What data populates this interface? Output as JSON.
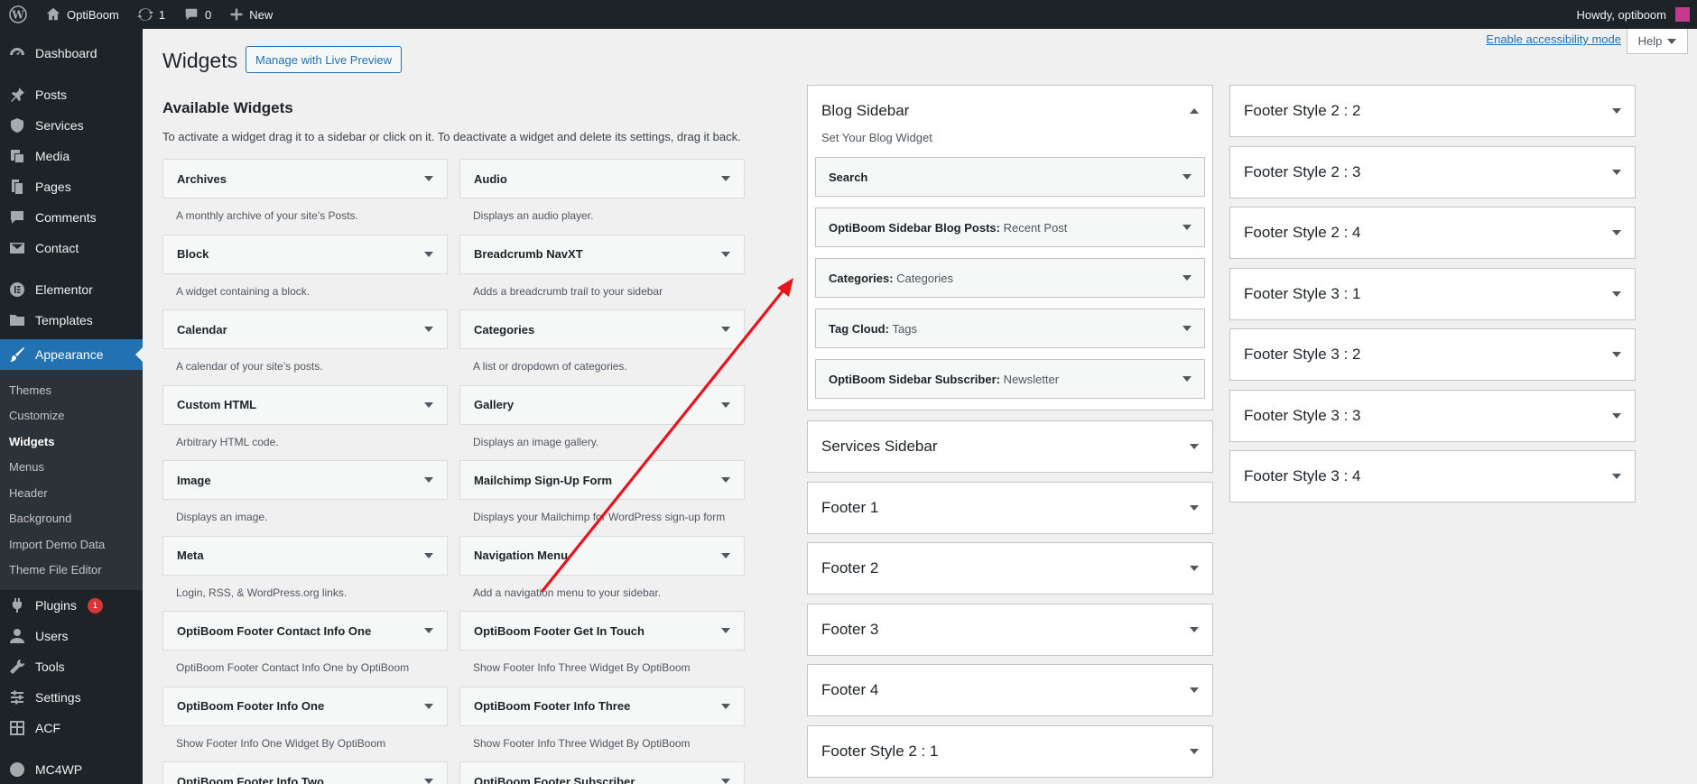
{
  "adminbar": {
    "site_name": "OptiBoom",
    "updates_count": "1",
    "comments_count": "0",
    "new_label": "New",
    "howdy": "Howdy, optiboom"
  },
  "menu": {
    "dashboard": "Dashboard",
    "posts": "Posts",
    "services": "Services",
    "media": "Media",
    "pages": "Pages",
    "comments": "Comments",
    "contact": "Contact",
    "elementor": "Elementor",
    "templates": "Templates",
    "appearance": "Appearance",
    "sub": [
      "Themes",
      "Customize",
      "Widgets",
      "Menus",
      "Header",
      "Background",
      "Import Demo Data",
      "Theme File Editor"
    ],
    "plugins": "Plugins",
    "plugins_badge": "1",
    "users": "Users",
    "tools": "Tools",
    "settings": "Settings",
    "acf": "ACF",
    "mc4wp": "MC4WP"
  },
  "page": {
    "title": "Widgets",
    "live_preview": "Manage with Live Preview",
    "a11y_link": "Enable accessibility mode",
    "help": "Help",
    "available_title": "Available Widgets",
    "available_desc": "To activate a widget drag it to a sidebar or click on it. To deactivate a widget and delete its settings, drag it back."
  },
  "widgets": [
    {
      "title": "Archives",
      "desc": "A monthly archive of your site’s Posts."
    },
    {
      "title": "Audio",
      "desc": "Displays an audio player."
    },
    {
      "title": "Block",
      "desc": "A widget containing a block."
    },
    {
      "title": "Breadcrumb NavXT",
      "desc": "Adds a breadcrumb trail to your sidebar"
    },
    {
      "title": "Calendar",
      "desc": "A calendar of your site’s posts."
    },
    {
      "title": "Categories",
      "desc": "A list or dropdown of categories."
    },
    {
      "title": "Custom HTML",
      "desc": "Arbitrary HTML code."
    },
    {
      "title": "Gallery",
      "desc": "Displays an image gallery."
    },
    {
      "title": "Image",
      "desc": "Displays an image."
    },
    {
      "title": "Mailchimp Sign-Up Form",
      "desc": "Displays your Mailchimp for WordPress sign-up form"
    },
    {
      "title": "Meta",
      "desc": "Login, RSS, & WordPress.org links."
    },
    {
      "title": "Navigation Menu",
      "desc": "Add a navigation menu to your sidebar."
    },
    {
      "title": "OptiBoom Footer Contact Info One",
      "desc": "OptiBoom Footer Contact Info One by OptiBoom"
    },
    {
      "title": "OptiBoom Footer Get In Touch",
      "desc": "Show Footer Info Three Widget By OptiBoom"
    },
    {
      "title": "OptiBoom Footer Info One",
      "desc": "Show Footer Info One Widget By OptiBoom"
    },
    {
      "title": "OptiBoom Footer Info Three",
      "desc": "Show Footer Info Three Widget By OptiBoom"
    },
    {
      "title": "OptiBoom Footer Info Two",
      "desc": ""
    },
    {
      "title": "OptiBoom Footer Subscriber",
      "desc": ""
    }
  ],
  "blog_sidebar": {
    "title": "Blog Sidebar",
    "desc": "Set Your Blog Widget",
    "items": [
      {
        "title": "Search",
        "sub": ""
      },
      {
        "title": "OptiBoom Sidebar Blog Posts:",
        "sub": "Recent Post"
      },
      {
        "title": "Categories:",
        "sub": "Categories"
      },
      {
        "title": "Tag Cloud:",
        "sub": "Tags"
      },
      {
        "title": "OptiBoom Sidebar Subscriber:",
        "sub": "Newsletter"
      }
    ]
  },
  "sidebars_col1": [
    "Services Sidebar",
    "Footer 1",
    "Footer 2",
    "Footer 3",
    "Footer 4",
    "Footer Style 2 : 1"
  ],
  "sidebars_col2": [
    "Footer Style 2 : 2",
    "Footer Style 2 : 3",
    "Footer Style 2 : 4",
    "Footer Style 3 : 1",
    "Footer Style 3 : 2",
    "Footer Style 3 : 3",
    "Footer Style 3 : 4"
  ]
}
